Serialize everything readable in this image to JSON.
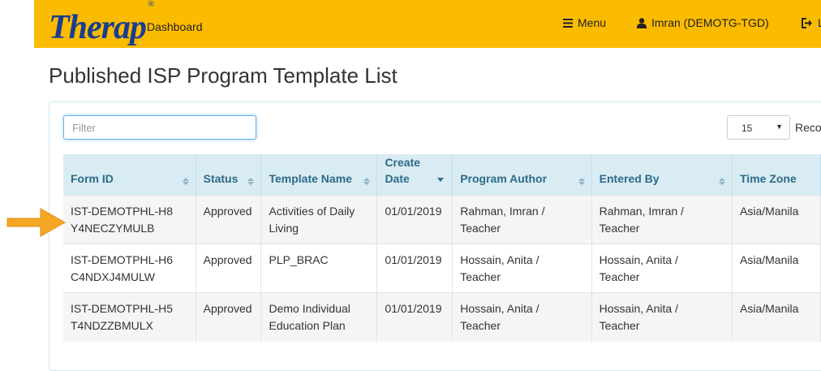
{
  "header": {
    "logo_text": "Therap",
    "logo_mark": "®",
    "dashboard_label": "Dashboard",
    "menu_label": "Menu",
    "user_label": "Imran (DEMOTG-TGD)",
    "logout_label": "L"
  },
  "page": {
    "title": "Published ISP Program Template List"
  },
  "filter": {
    "placeholder": "Filter",
    "value": ""
  },
  "pagination": {
    "page_size": "15",
    "records_label": "Reco"
  },
  "table": {
    "columns": [
      {
        "label": "Form ID"
      },
      {
        "label": "Status"
      },
      {
        "label": "Template Name"
      },
      {
        "label": "Create Date"
      },
      {
        "label": "Program Author"
      },
      {
        "label": "Entered By"
      },
      {
        "label": "Time Zone"
      }
    ],
    "rows": [
      {
        "form_id": "IST-DEMOTPHL-H8Y4NECZYMULB",
        "status": "Approved",
        "template_name": "Activities of Daily Living",
        "create_date": "01/01/2019",
        "program_author": "Rahman, Imran / Teacher",
        "entered_by": "Rahman, Imran / Teacher",
        "time_zone": "Asia/Manila"
      },
      {
        "form_id": "IST-DEMOTPHL-H6C4NDXJ4MULW",
        "status": "Approved",
        "template_name": "PLP_BRAC",
        "create_date": "01/01/2019",
        "program_author": "Hossain, Anita / Teacher",
        "entered_by": "Hossain, Anita / Teacher",
        "time_zone": "Asia/Manila"
      },
      {
        "form_id": "IST-DEMOTPHL-H5T4NDZZBMULX",
        "status": "Approved",
        "template_name": "Demo Individual Education Plan",
        "create_date": "01/01/2019",
        "program_author": "Hossain, Anita / Teacher",
        "entered_by": "Hossain, Anita / Teacher",
        "time_zone": "Asia/Manila"
      }
    ]
  },
  "colors": {
    "header_bg": "#fbbb00",
    "logo": "#1a3d8f",
    "table_header_bg": "#d9ecf4",
    "table_header_text": "#2d6a88",
    "arrow": "#f5a623"
  }
}
